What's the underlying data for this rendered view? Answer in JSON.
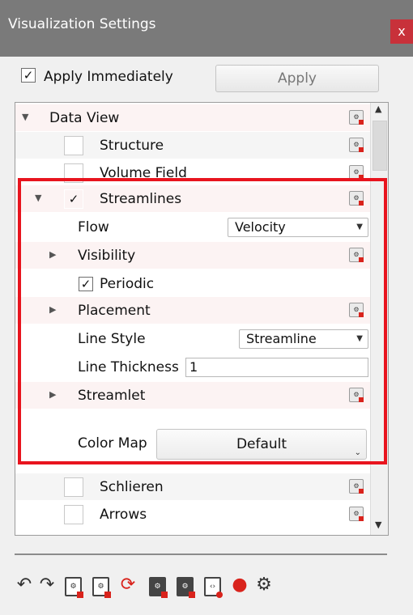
{
  "window": {
    "title": "Visualization Settings",
    "close_glyph": "x"
  },
  "apply": {
    "immediately_label": "Apply Immediately",
    "immediately_checked": true,
    "button_label": "Apply"
  },
  "tree": {
    "data_view": "Data View",
    "structure": "Structure",
    "volume_field": "Volume Field",
    "streamlines": "Streamlines",
    "flow_label": "Flow",
    "flow_value": "Velocity",
    "visibility": "Visibility",
    "periodic": "Periodic",
    "placement": "Placement",
    "line_style_label": "Line Style",
    "line_style_value": "Streamline",
    "line_thickness_label": "Line Thickness",
    "line_thickness_value": "1",
    "streamlet": "Streamlet",
    "color_map_label": "Color Map",
    "color_map_value": "Default",
    "schlieren": "Schlieren",
    "arrows": "Arrows"
  },
  "glyphs": {
    "check": "✓",
    "expanded": "▼",
    "collapsed": "▶",
    "caret": "▼",
    "scroll_up": "▲",
    "scroll_down": "▼"
  },
  "toolbar": {
    "icons": [
      "undo-icon",
      "redo-icon",
      "reset-settings-icon",
      "reset-all-icon",
      "rotate-icon",
      "save-dark-icon",
      "load-dark-icon",
      "export-icon",
      "eye-icon",
      "gear-icon"
    ]
  },
  "colors": {
    "titlebar": "#7a7a7a",
    "close": "#c8313a",
    "highlight": "#e8141e",
    "row_tint": "#fcf3f3"
  }
}
